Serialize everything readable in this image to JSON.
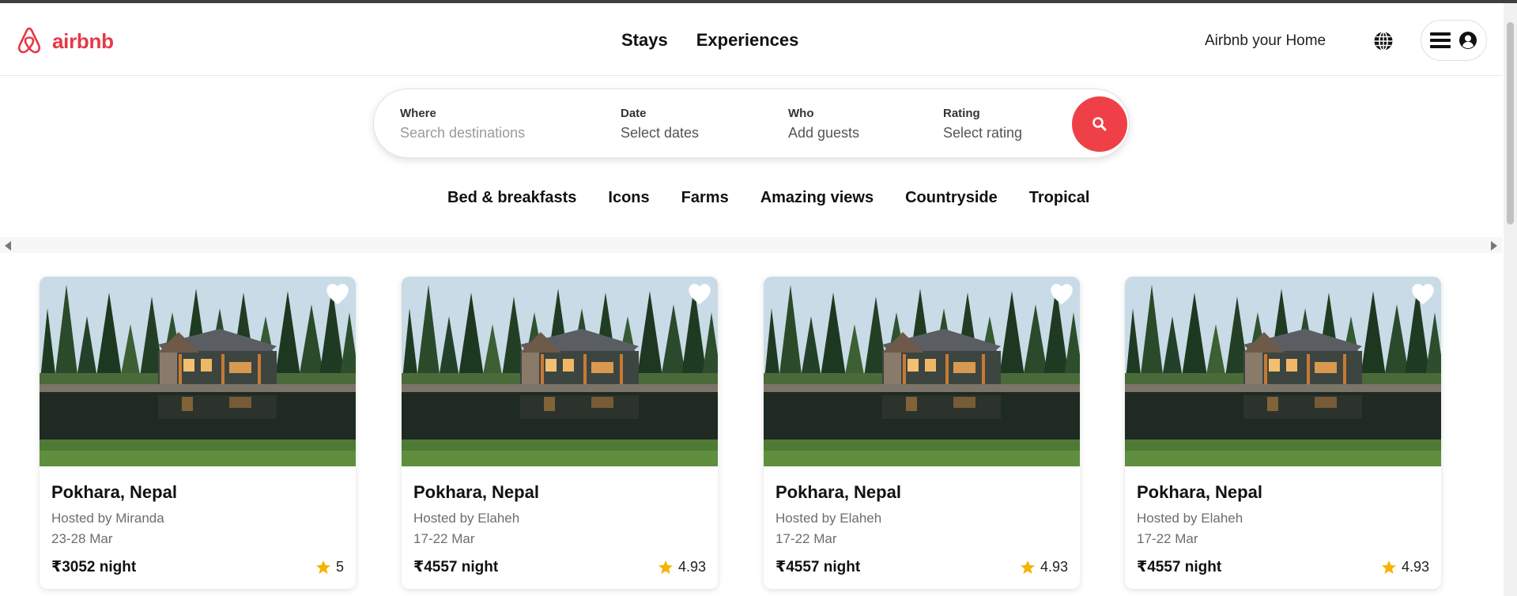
{
  "header": {
    "logo_text": "airbnb",
    "nav": [
      "Stays",
      "Experiences"
    ],
    "host_link": "Airbnb your Home"
  },
  "search": {
    "where": {
      "label": "Where",
      "placeholder": "Search destinations"
    },
    "date": {
      "label": "Date",
      "value": "Select dates"
    },
    "who": {
      "label": "Who",
      "value": "Add guests"
    },
    "rating": {
      "label": "Rating",
      "value": "Select rating"
    }
  },
  "categories": [
    "Bed & breakfasts",
    "Icons",
    "Farms",
    "Amazing views",
    "Countryside",
    "Tropical"
  ],
  "listings": [
    {
      "title": "Pokhara, Nepal",
      "host": "Hosted by Miranda",
      "dates": "23-28 Mar",
      "price": "₹3052 night",
      "rating": "5"
    },
    {
      "title": "Pokhara, Nepal",
      "host": "Hosted by Elaheh",
      "dates": "17-22 Mar",
      "price": "₹4557 night",
      "rating": "4.93"
    },
    {
      "title": "Pokhara, Nepal",
      "host": "Hosted by Elaheh",
      "dates": "17-22 Mar",
      "price": "₹4557 night",
      "rating": "4.93"
    },
    {
      "title": "Pokhara, Nepal",
      "host": "Hosted by Elaheh",
      "dates": "17-22 Mar",
      "price": "₹4557 night",
      "rating": "4.93"
    }
  ],
  "colors": {
    "brand": "#e53945",
    "search_button": "#ef4048",
    "star": "#f5b400"
  },
  "icons": {
    "logo": "airbnb-logo-icon",
    "globe": "globe-icon",
    "menu": "hamburger-icon",
    "account": "user-circle-icon",
    "search": "search-icon",
    "favorite": "heart-icon",
    "rating": "star-icon"
  }
}
